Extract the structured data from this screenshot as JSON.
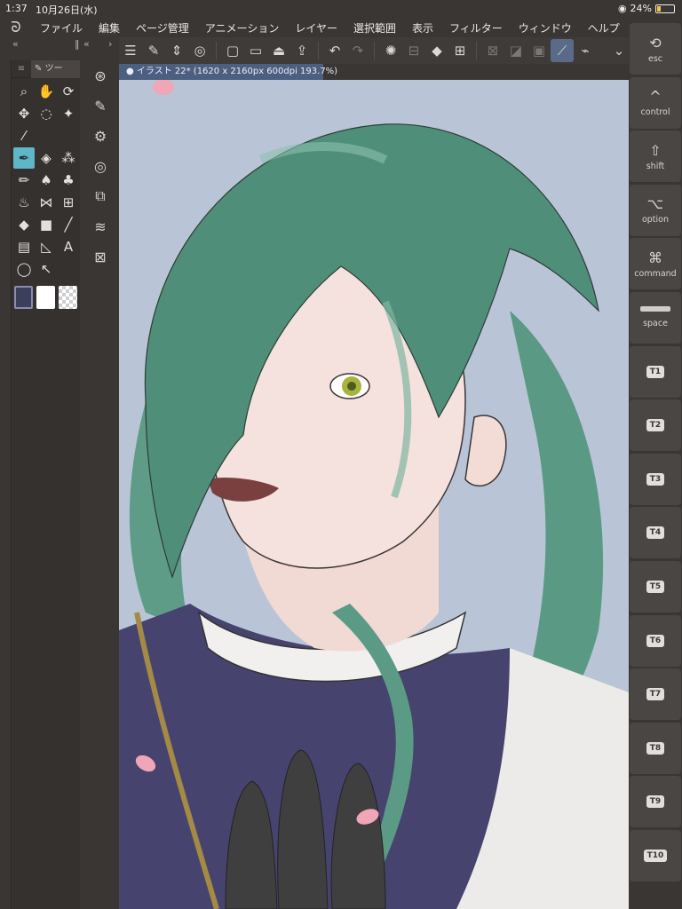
{
  "status": {
    "time": "1:37",
    "date": "10月26日(水)",
    "battery": "24%",
    "battery_level": 0.24
  },
  "menu": {
    "items": [
      "ファイル",
      "編集",
      "ページ管理",
      "アニメーション",
      "レイヤー",
      "選択範囲",
      "表示",
      "フィルター",
      "ウィンドウ",
      "ヘルプ"
    ]
  },
  "palette_header": {
    "left_arrows": "«",
    "mid_arrows": "«",
    "right_arrows": "›"
  },
  "tool_palette": {
    "tab_icon": "menu-icon",
    "tab_label": "ツー",
    "tools": [
      "zoom-icon",
      "hand-icon",
      "rotate-icon",
      "move-icon",
      "lasso-icon",
      "magic-wand-icon",
      "eyedropper-icon",
      "pen-icon",
      "eraser-icon",
      "decoration-icon",
      "pencil-icon",
      "ink-icon",
      "blend-icon",
      "airbrush-icon",
      "figure-icon",
      "fill-icon",
      "gradient-icon",
      "line-icon",
      "frame-icon",
      "ruler-icon",
      "text-icon",
      "balloon-icon",
      "correct-line-icon"
    ],
    "selected_tool": "pen-icon"
  },
  "canvas": {
    "tab_title": "イラスト 22* (1620 x 2160px 600dpi 193.7%)",
    "background_color": "#b9c5d7"
  },
  "edge_keys": [
    {
      "symbol": "⟲",
      "label": "esc"
    },
    {
      "symbol": "^",
      "label": "control"
    },
    {
      "symbol": "⇧",
      "label": "shift"
    },
    {
      "symbol": "⌥",
      "label": "option"
    },
    {
      "symbol": "⌘",
      "label": "command"
    },
    {
      "symbol": "",
      "label": "space"
    },
    {
      "tag": "T1"
    },
    {
      "tag": "T2"
    },
    {
      "tag": "T3"
    },
    {
      "tag": "T4"
    },
    {
      "tag": "T5"
    },
    {
      "tag": "T6"
    },
    {
      "tag": "T7"
    },
    {
      "tag": "T8"
    },
    {
      "tag": "T9"
    },
    {
      "tag": "T10"
    }
  ]
}
